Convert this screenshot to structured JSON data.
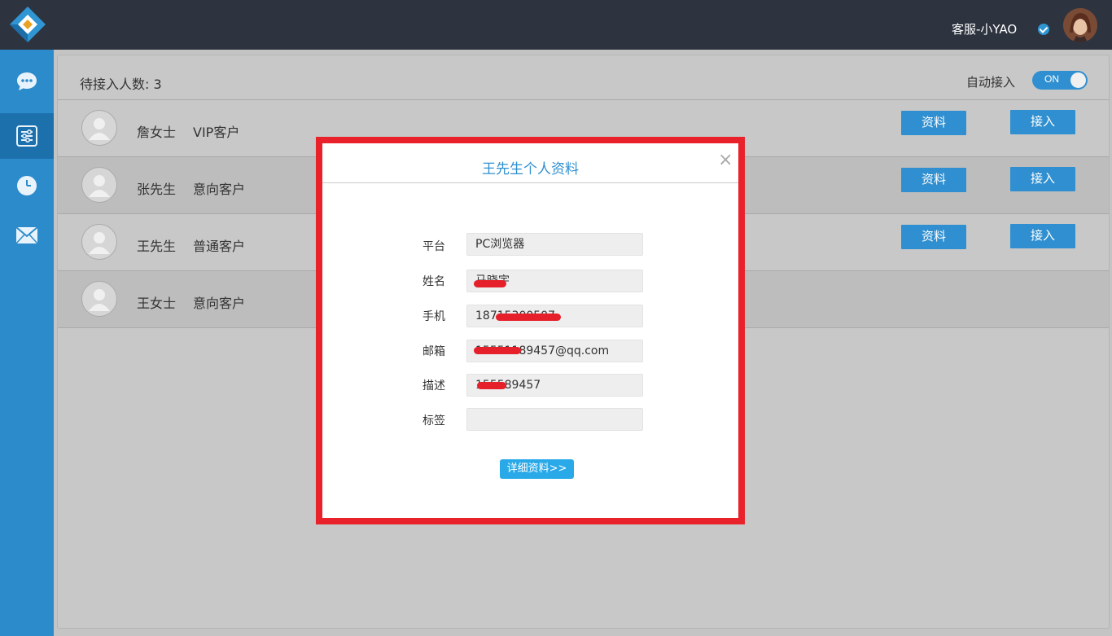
{
  "header": {
    "agent_name": "客服-小YAO"
  },
  "sidebar": {
    "items": [
      {
        "name": "chat",
        "icon": "chat-bubble-icon"
      },
      {
        "name": "settings",
        "icon": "sliders-icon",
        "active": true
      },
      {
        "name": "history",
        "icon": "clock-icon"
      },
      {
        "name": "mail",
        "icon": "envelope-icon"
      }
    ]
  },
  "main": {
    "queue_label": "待接入人数: 3",
    "auto_accept_label": "自动接入",
    "toggle_text": "ON",
    "rows": [
      {
        "name": "詹女士",
        "type": "VIP客户",
        "info_label": "资料",
        "accept_label": "接入"
      },
      {
        "name": "张先生",
        "type": "意向客户",
        "info_label": "资料",
        "accept_label": "接入"
      },
      {
        "name": "王先生",
        "type": "普通客户",
        "info_label": "资料",
        "accept_label": "接入"
      },
      {
        "name": "王女士",
        "type": "意向客户"
      }
    ]
  },
  "modal": {
    "title": "王先生个人资料",
    "close": "×",
    "fields": [
      {
        "label": "平台",
        "value": "PC浏览器"
      },
      {
        "label": "姓名",
        "value": "马晓宇"
      },
      {
        "label": "手机",
        "value": "18715300507"
      },
      {
        "label": "邮箱",
        "value": "15551189457@qq.com"
      },
      {
        "label": "描述",
        "value": "155589457"
      },
      {
        "label": "标签",
        "value": ""
      }
    ],
    "detail_button": "详细资料>>"
  },
  "colors": {
    "header_bg": "#2d333f",
    "sidebar_bg": "#2c8ccb",
    "accent": "#2f8fd0",
    "highlight": "#e8212b"
  }
}
